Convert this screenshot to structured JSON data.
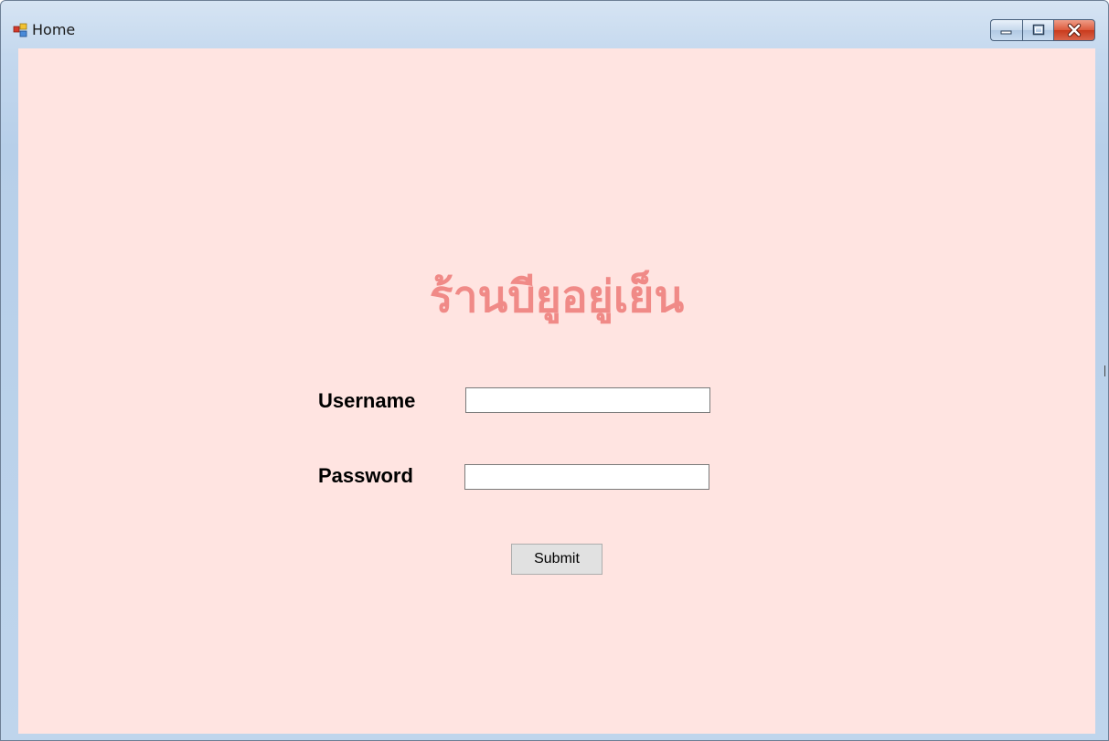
{
  "window": {
    "title": "Home",
    "controls": {
      "minimize_icon": "minimize-icon",
      "maximize_icon": "maximize-icon",
      "close_icon": "close-icon"
    }
  },
  "form": {
    "shop_name": "ร้านบียูอยู่เย็น",
    "username_label": "Username",
    "username_value": "",
    "password_label": "Password",
    "password_value": "",
    "submit_label": "Submit"
  },
  "colors": {
    "background": "#ffe4e1",
    "title_color": "#f08a87",
    "close_button": "#c93a1c"
  }
}
